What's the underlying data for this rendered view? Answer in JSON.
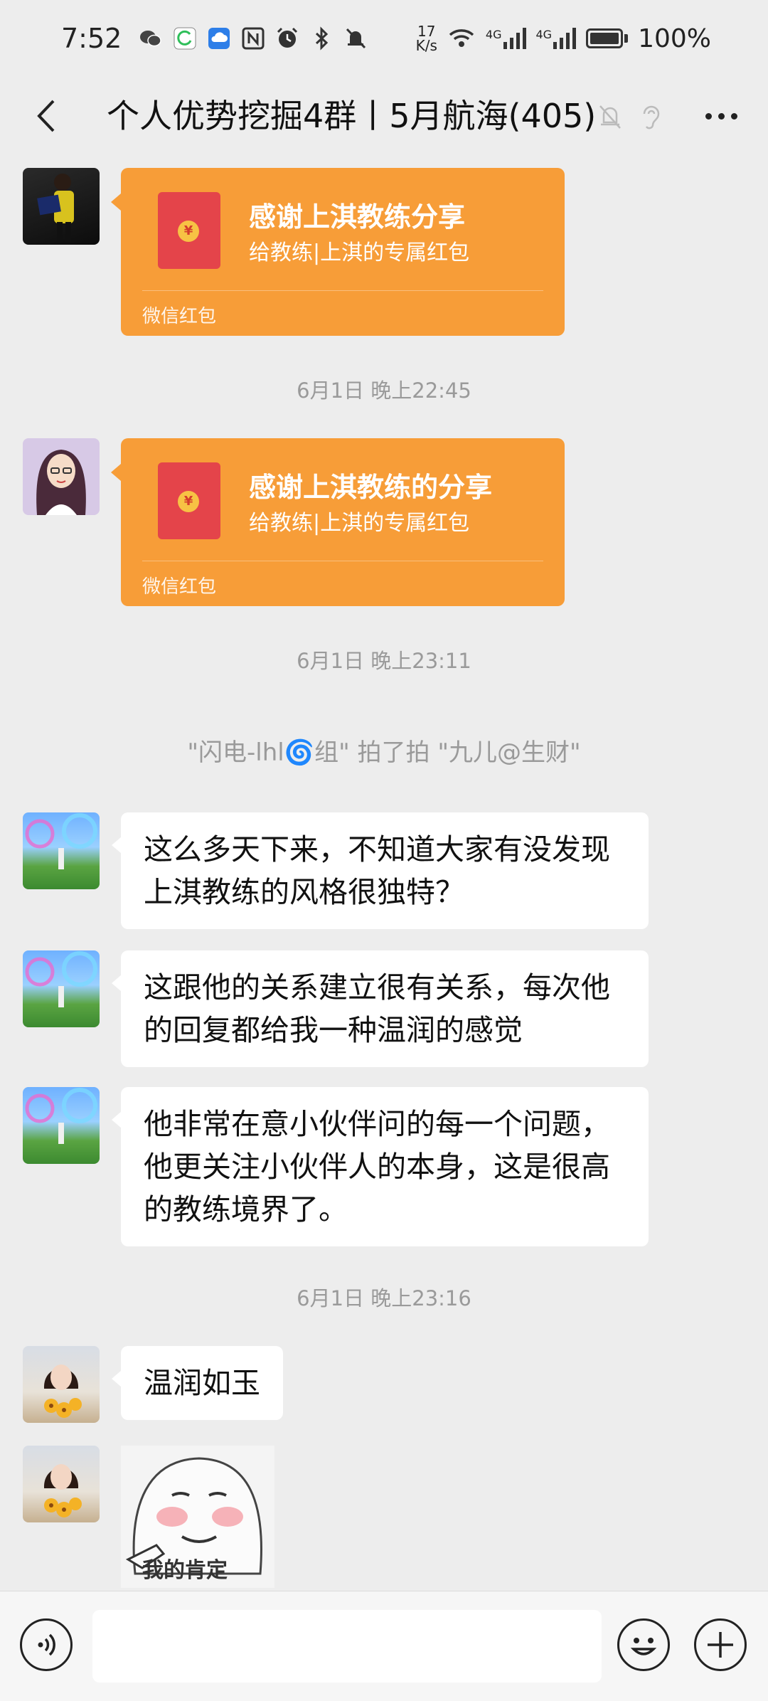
{
  "status_bar": {
    "time": "7:52",
    "net_speed_value": "17",
    "net_speed_unit": "K/s",
    "signal1_label": "4G",
    "signal2_label": "4G",
    "battery": "100%",
    "battery_level": 1.0
  },
  "header": {
    "title": "个人优势挖掘4群丨5月航海(405)"
  },
  "messages": {
    "rp1": {
      "title": "感谢上淇教练分享",
      "subtitle": "给教练|上淇的专属红包",
      "footer": "微信红包"
    },
    "ts1": "6月1日 晚上22:45",
    "rp2": {
      "title": "感谢上淇教练的分享",
      "subtitle": "给教练|上淇的专属红包",
      "footer": "微信红包"
    },
    "ts2": "6月1日 晚上23:11",
    "system": "\"闪电-lhl🌀组\" 拍了拍 \"九儿@生财\"",
    "text1": "这么多天下来，不知道大家有没发现上淇教练的风格很独特？",
    "text2": "这跟他的关系建立很有关系，每次他的回复都给我一种温润的感觉",
    "text3": "他非常在意小伙伴问的每一个问题，他更关注小伙伴人的本身，这是很高的教练境界了。",
    "ts3": "6月1日 晚上23:16",
    "text4": "温润如玉",
    "sticker_caption": "我的肯定"
  },
  "input": {
    "value": ""
  }
}
